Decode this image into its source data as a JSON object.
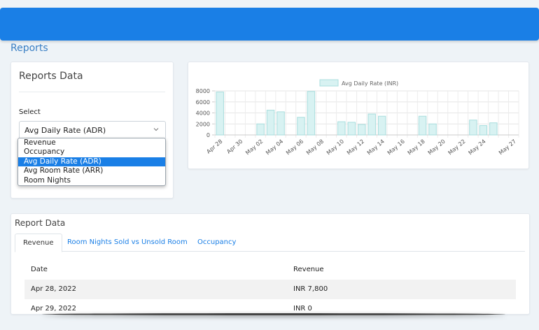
{
  "page": {
    "title": "Reports"
  },
  "reports_card": {
    "heading": "Reports Data",
    "select_label": "Select",
    "selected": "Avg Daily Rate (ADR)",
    "options": [
      "Revenue",
      "Occupancy",
      "Avg Daily Rate (ADR)",
      "Avg Room Rate (ARR)",
      "Room Nights"
    ]
  },
  "chart_data": {
    "type": "bar",
    "legend": "Avg Daily Rate (INR)",
    "legend_position": "top",
    "color": "#d8f2f2",
    "border_color": "#a9dede",
    "ylim": [
      0,
      8000
    ],
    "yticks": [
      0,
      2000,
      4000,
      6000,
      8000
    ],
    "grid": true,
    "categories": [
      "Apr 28",
      "Apr 29",
      "Apr 30",
      "May 01",
      "May 02",
      "May 03",
      "May 04",
      "May 05",
      "May 06",
      "May 07",
      "May 08",
      "May 09",
      "May 10",
      "May 11",
      "May 12",
      "May 13",
      "May 14",
      "May 15",
      "May 16",
      "May 17",
      "May 18",
      "May 19",
      "May 20",
      "May 21",
      "May 22",
      "May 23",
      "May 24",
      "May 25",
      "May 26",
      "May 27"
    ],
    "tick_labels": [
      "Apr 28",
      "Apr 30",
      "May 02",
      "May 04",
      "May 06",
      "May 08",
      "May 10",
      "May 12",
      "May 14",
      "May 16",
      "May 18",
      "May 20",
      "May 22",
      "May 24",
      "May 27"
    ],
    "values": [
      7800,
      0,
      0,
      0,
      2000,
      4500,
      4200,
      0,
      3200,
      7900,
      0,
      0,
      2400,
      2300,
      1900,
      3800,
      3400,
      0,
      0,
      0,
      3400,
      2000,
      0,
      0,
      0,
      2700,
      1700,
      2200,
      0,
      0
    ]
  },
  "report": {
    "heading": "Report Data",
    "tabs": [
      "Revenue",
      "Room Nights Sold vs Unsold Room",
      "Occupancy"
    ],
    "columns": [
      "Date",
      "Revenue"
    ],
    "rows": [
      {
        "date": "Apr 28, 2022",
        "revenue": "INR 7,800"
      },
      {
        "date": "Apr 29, 2022",
        "revenue": "INR 0"
      }
    ]
  }
}
